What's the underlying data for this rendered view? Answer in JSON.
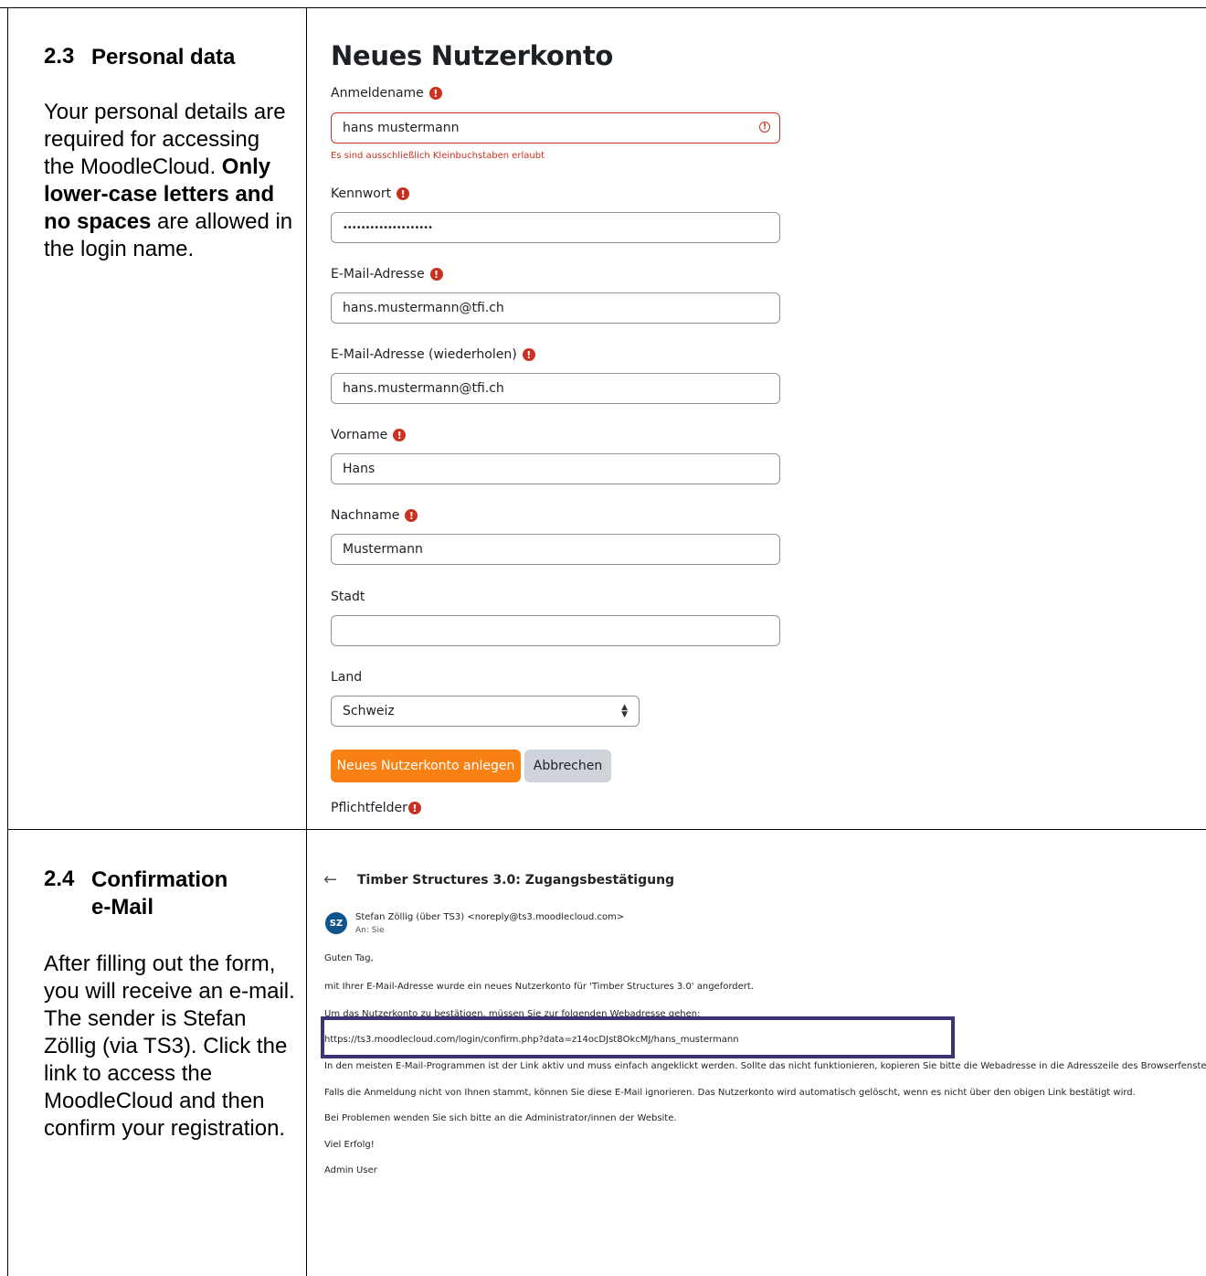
{
  "section_personal": {
    "number": "2.3",
    "title": "Personal data",
    "body_1": "Your personal details are required for accessing the MoodleCloud. ",
    "body_bold": "Only lower-case letters and no spaces",
    "body_2": " are allowed in the login name."
  },
  "form": {
    "title": "Neues Nutzerkonto",
    "required_icon": "exclamation-circle-icon",
    "fields": {
      "username": {
        "label": "Anmeldename",
        "value": "hans mustermann",
        "error": "Es sind ausschließlich Kleinbuchstaben erlaubt"
      },
      "password": {
        "label": "Kennwort",
        "value": "••••••••••••••••••••"
      },
      "email": {
        "label": "E-Mail-Adresse",
        "value": "hans.mustermann@tfi.ch"
      },
      "email2": {
        "label": "E-Mail-Adresse (wiederholen)",
        "value": "hans.mustermann@tfi.ch"
      },
      "firstname": {
        "label": "Vorname",
        "value": "Hans"
      },
      "lastname": {
        "label": "Nachname",
        "value": "Mustermann"
      },
      "city": {
        "label": "Stadt",
        "value": ""
      },
      "country": {
        "label": "Land",
        "value": "Schweiz"
      }
    },
    "submit_label": "Neues Nutzerkonto anlegen",
    "cancel_label": "Abbrechen",
    "required_note": "Pflichtfelder",
    "colors": {
      "primary": "#f98012",
      "error": "#ca3120",
      "secondary": "#ced4da"
    }
  },
  "section_confirm": {
    "number": "2.4",
    "title_line1": "Confirmation",
    "title_line2": "e-Mail",
    "body": "After filling out the form, you will receive an e-mail. The sender is Stefan Zöllig (via TS3). Click the link to access the MoodleCloud and then confirm your registration."
  },
  "email": {
    "subject": "Timber Structures 3.0: Zugangsbestätigung",
    "avatar_initials": "SZ",
    "sender": "Stefan Zöllig (über TS3) <noreply@ts3.moodlecloud.com>",
    "to": "An: Sie",
    "greeting": "Guten Tag,",
    "line1": "mit Ihrer E-Mail-Adresse wurde ein neues Nutzerkonto für 'Timber Structures 3.0' angefordert.",
    "line2": "Um das Nutzerkonto zu bestätigen, müssen Sie zur folgenden Webadresse gehen:",
    "link": "https://ts3.moodlecloud.com/login/confirm.php?data=z14ocDJst8OkcMJ/hans_mustermann",
    "line3": "In den meisten E-Mail-Programmen ist der Link aktiv und muss einfach angeklickt werden. Sollte das nicht funktionieren, kopieren Sie bitte die Webadresse in die Adresszeile des Browserfensters.",
    "line4": "Falls die Anmeldung nicht von Ihnen stammt, können Sie diese E-Mail ignorieren. Das Nutzerkonto wird automatisch gelöscht, wenn es nicht über den obigen Link bestätigt wird.",
    "line5": "Bei Problemen wenden Sie sich bitte an die Administrator/innen der Website.",
    "closing": "Viel Erfolg!",
    "signature": "Admin User",
    "highlight_color": "#3b3576"
  }
}
